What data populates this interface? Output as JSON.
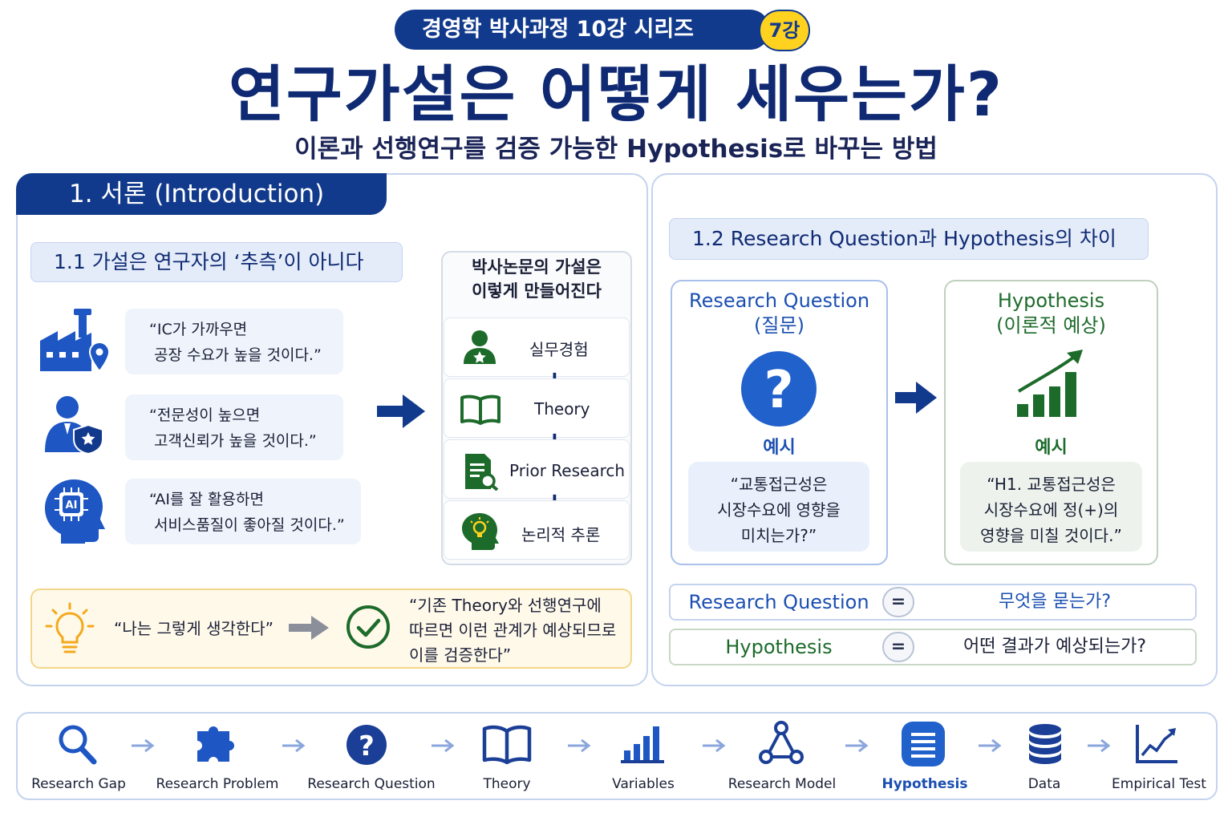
{
  "header": {
    "series": "경영학 박사과정 10강 시리즈",
    "lecture": "7강",
    "title": "연구가설은 어떻게 세우는가?",
    "subtitle": "이론과 선행연구를 검증 가능한 Hypothesis로 바꾸는 방법"
  },
  "section1": {
    "tab": "1. 서론 (Introduction)",
    "sub1": {
      "title": "1.1  가설은 연구자의 ‘추측’이 아니다",
      "quotes": [
        {
          "icon": "factory-location-icon",
          "line1": "“IC가 가까우면",
          "line2": "공장 수요가 높을 것이다.”"
        },
        {
          "icon": "professional-shield-icon",
          "line1": "“전문성이 높으면",
          "line2": "고객신뢰가 높을 것이다.”"
        },
        {
          "icon": "ai-head-icon",
          "line1": "“AI를 잘 활용하면",
          "line2": "서비스품질이 좋아질 것이다.”"
        }
      ],
      "recipe_title_1": "박사논문의 가설은",
      "recipe_title_2": "이렇게 만들어진다",
      "recipe_items": [
        "실무경험",
        "Theory",
        "Prior Research",
        "논리적 추론"
      ],
      "plus": "+",
      "compare_left": "“나는 그렇게 생각한다”",
      "compare_right_1": "“기존 Theory와 선행연구에",
      "compare_right_2": "따르면 이런 관계가 예상되므로",
      "compare_right_3": "이를 검증한다”"
    },
    "sub2": {
      "title": "1.2  Research Question과 Hypothesis의 차이",
      "rq": {
        "title1": "Research Question",
        "title2": "(질문)",
        "example_label": "예시",
        "ex1": "“교통접근성은",
        "ex2": "시장수요에 영향을",
        "ex3": "미치는가?”"
      },
      "hyp": {
        "title1": "Hypothesis",
        "title2": "(이론적 예상)",
        "example_label": "예시",
        "ex1": "“H1. 교통접근성은",
        "ex2": "시장수요에 정(+)의",
        "ex3": "영향을 미칠 것이다.”"
      },
      "defs": [
        {
          "term": "Research Question",
          "eq": "=",
          "desc": "무엇을 묻는가?"
        },
        {
          "term": "Hypothesis",
          "eq": "=",
          "desc": "어떤 결과가 예상되는가?"
        }
      ]
    }
  },
  "flow": {
    "steps": [
      {
        "label": "Research Gap",
        "icon": "magnifier-icon"
      },
      {
        "label": "Research Problem",
        "icon": "puzzle-icon"
      },
      {
        "label": "Research Question",
        "icon": "question-icon"
      },
      {
        "label": "Theory",
        "icon": "book-icon"
      },
      {
        "label": "Variables",
        "icon": "bar-chart-icon"
      },
      {
        "label": "Research Model",
        "icon": "network-icon"
      },
      {
        "label": "Hypothesis",
        "icon": "list-document-icon"
      },
      {
        "label": "Data",
        "icon": "database-icon"
      },
      {
        "label": "Empirical Test",
        "icon": "line-chart-icon"
      }
    ],
    "active": "Hypothesis"
  },
  "colors": {
    "navy": "#123a8c",
    "title_navy": "#0f2a73",
    "blue": "#1b4fb2",
    "green": "#1d6b2b",
    "yellow": "#ffd21f"
  }
}
